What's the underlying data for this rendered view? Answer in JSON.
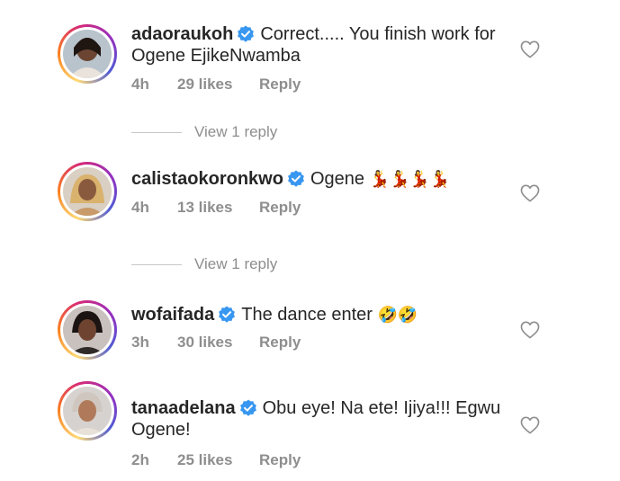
{
  "comments": [
    {
      "username": "adaoraukoh",
      "text": "Correct..... You finish work for Ogene EjikeNwamba",
      "time": "4h",
      "likes": "29 likes",
      "reply": "Reply",
      "view_replies": "View 1 reply"
    },
    {
      "username": "calistaokoronkwo",
      "text": "Ogene",
      "emojis": "💃💃💃💃",
      "time": "4h",
      "likes": "13 likes",
      "reply": "Reply",
      "view_replies": "View 1 reply"
    },
    {
      "username": "wofaifada",
      "text": "The dance enter",
      "emojis": "🤣🤣",
      "time": "3h",
      "likes": "30 likes",
      "reply": "Reply"
    },
    {
      "username": "tanaadelana",
      "text": "Obu eye! Na ete! Ijiya!!! Egwu Ogene!",
      "time": "2h",
      "likes": "25 likes",
      "reply": "Reply"
    }
  ],
  "colors": {
    "verified": "#3897f0",
    "muted": "#8e8e8e",
    "text": "#262626"
  },
  "icons": {
    "verified": "verified-badge-icon",
    "like": "heart-outline-icon"
  }
}
